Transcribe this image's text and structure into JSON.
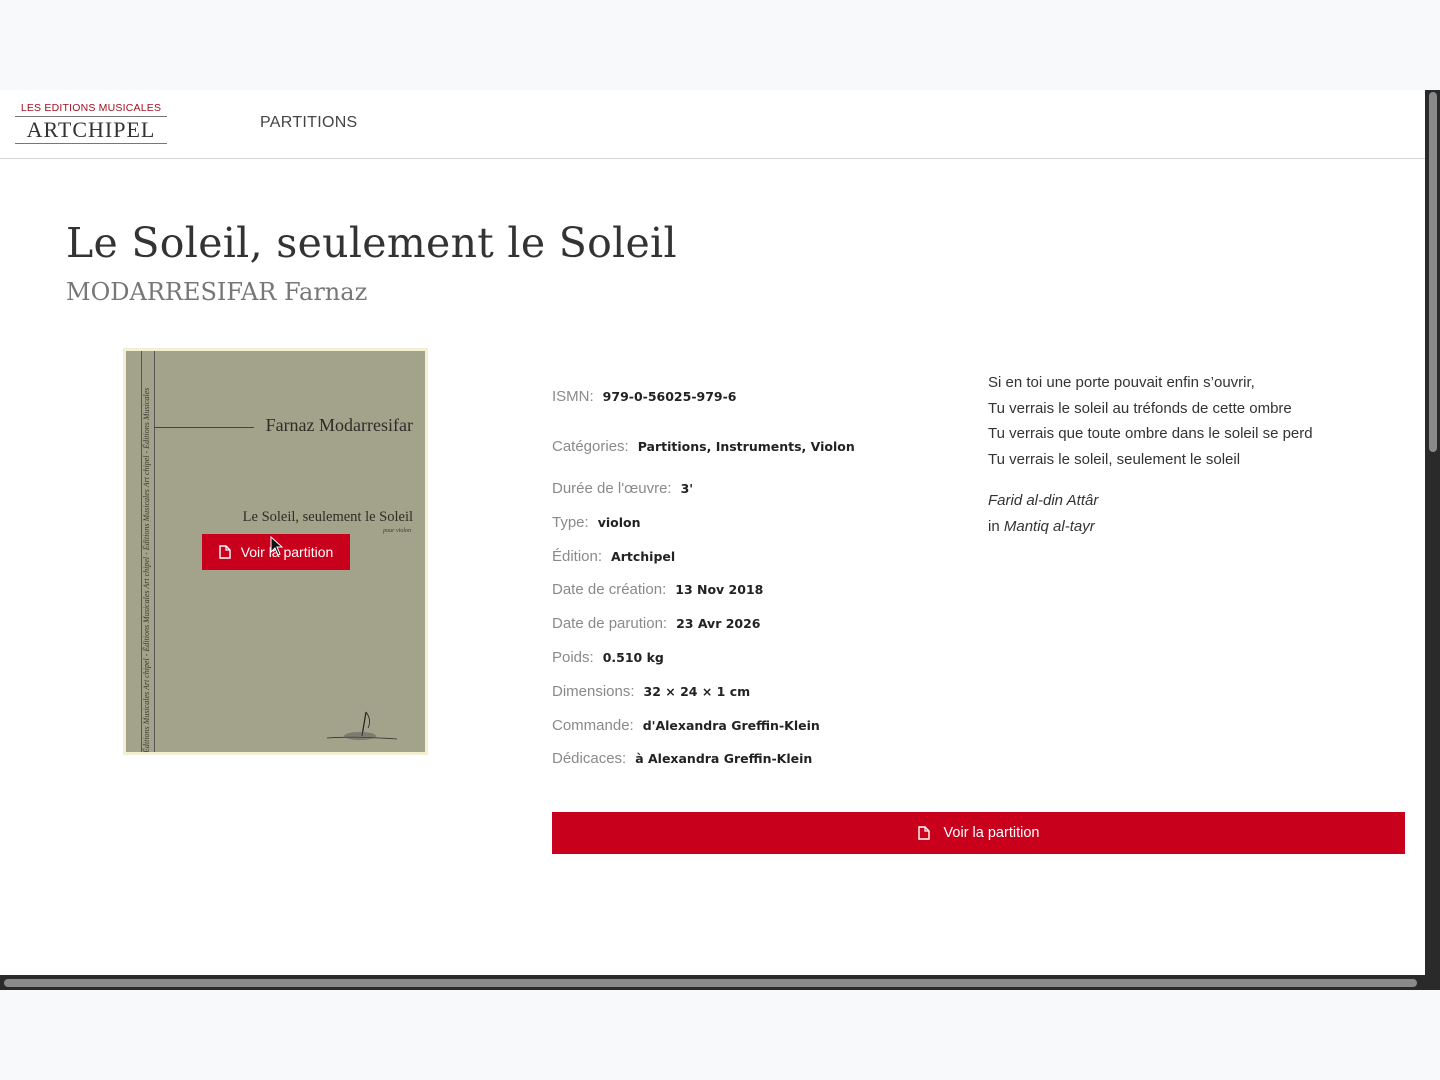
{
  "header": {
    "logo_top": "LES EDITIONS MUSICALES",
    "logo_main": "ARTCHIPEL",
    "nav": {
      "partitions": "PARTITIONS"
    }
  },
  "work": {
    "title": "Le Soleil, seulement le Soleil",
    "composer": "MODARRESIFAR Farnaz"
  },
  "cover": {
    "author": "Farnaz Modarresifar",
    "title": "Le Soleil, seulement le Soleil",
    "subtitle": "pour violon",
    "strip_text": "Éditions Musicales Art chipel - Éditions Musicales Art chipel - Éditions Musicales Art chipel - Éditions Musicales",
    "mark_text": "Les Éditions Musicales Art chipel",
    "button_label": "Voir la partition",
    "icon": "file-icon"
  },
  "details": [
    {
      "key": "isbn",
      "label": "ISMN:",
      "value": "979-0-56025-979-6"
    },
    {
      "key": "categories",
      "label": "Catégories:",
      "value": "Partitions, Instruments, Violon"
    },
    {
      "key": "duration",
      "label": "Durée de l'œuvre:",
      "value": "3'"
    },
    {
      "key": "type",
      "label": "Type:",
      "value": "violon"
    },
    {
      "key": "edition",
      "label": "Édition:",
      "value": "Artchipel"
    },
    {
      "key": "creation",
      "label": "Date de création:",
      "value": "13 Nov 2018"
    },
    {
      "key": "release",
      "label": "Date de parution:",
      "value": "23 Avr 2026"
    },
    {
      "key": "weight",
      "label": "Poids:",
      "value": "0.510 kg"
    },
    {
      "key": "dimensions",
      "label": "Dimensions:",
      "value": "32 × 24 × 1 cm"
    },
    {
      "key": "commission",
      "label": "Commande:",
      "value": "d'Alexandra Greffin-Klein"
    },
    {
      "key": "dedication",
      "label": "Dédicaces:",
      "value": "à Alexandra Greffin-Klein"
    }
  ],
  "poem": {
    "lines": [
      "Si en toi une porte pouvait enfin s’ouvrir,",
      "Tu verrais le soleil au tréfonds de cette ombre",
      "Tu verrais que toute ombre dans le soleil se perd",
      "Tu verrais le soleil, seulement le soleil"
    ],
    "author": "Farid al-din Attâr",
    "source_prefix": "in",
    "source": "Mantiq al-tayr"
  },
  "main_button": {
    "label": "Voir la partition",
    "icon": "file-icon"
  },
  "colors": {
    "accent": "#c8001c",
    "cover": "#a3a28a",
    "logo_red": "#a01020"
  }
}
